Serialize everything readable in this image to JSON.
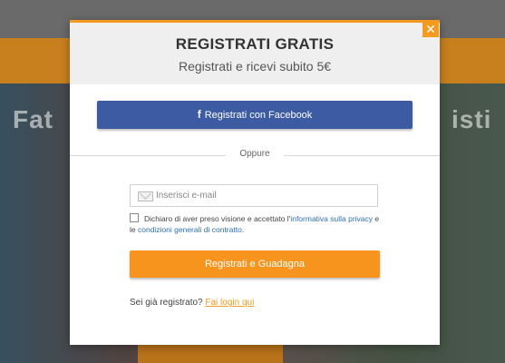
{
  "background": {
    "left_hero_text": "Fat",
    "right_hero_text": "isti"
  },
  "modal": {
    "title": "REGISTRATI GRATIS",
    "subtitle": "Registrati e ricevi subito 5€",
    "close_glyph": "✕",
    "facebook_icon": "f",
    "facebook_label": "Registrati con Facebook",
    "divider_text": "Oppure",
    "email_placeholder": "Inserisci e-mail",
    "email_value": "",
    "terms": {
      "checked": false,
      "text_before": "Dichiaro di aver preso visione e accettato l'",
      "link1": "informativa sulla privacy",
      "text_middle": " e le ",
      "link2": "condizioni generali di contratto",
      "text_after": "."
    },
    "cta_label": "Registrati e Guadagna",
    "login_prompt": "Sei già registrato?",
    "login_link": "Fai login qui"
  },
  "colors": {
    "accent_orange": "#f7941d",
    "facebook_blue": "#3c5ba3",
    "link_blue": "#2e6fb5"
  },
  "icons": {
    "close": "close-icon",
    "facebook": "facebook-icon",
    "email": "mail-icon",
    "dropdown": "chevron-down-icon"
  }
}
